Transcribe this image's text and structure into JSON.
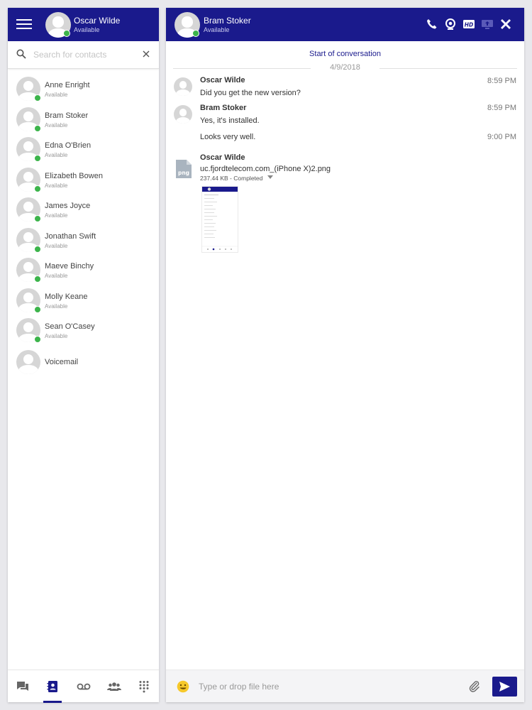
{
  "colors": {
    "brand": "#1a1a8c",
    "available": "#3cb44b"
  },
  "me": {
    "name": "Oscar Wilde",
    "status": "Available"
  },
  "search": {
    "placeholder": "Search for contacts",
    "value": ""
  },
  "contacts": [
    {
      "name": "Anne Enright",
      "status": "Available"
    },
    {
      "name": "Bram Stoker",
      "status": "Available"
    },
    {
      "name": "Edna O'Brien",
      "status": "Available"
    },
    {
      "name": "Elizabeth Bowen",
      "status": "Available"
    },
    {
      "name": "James Joyce",
      "status": "Available"
    },
    {
      "name": "Jonathan Swift",
      "status": "Available"
    },
    {
      "name": "Maeve Binchy",
      "status": "Available"
    },
    {
      "name": "Molly Keane",
      "status": "Available"
    },
    {
      "name": "Sean O'Casey",
      "status": "Available"
    },
    {
      "name": "Voicemail",
      "status": ""
    }
  ],
  "bottom_nav": [
    {
      "icon": "chat-icon",
      "active": false
    },
    {
      "icon": "contacts-book-icon",
      "active": true
    },
    {
      "icon": "voicemail-icon",
      "active": false
    },
    {
      "icon": "group-icon",
      "active": false
    },
    {
      "icon": "dialpad-icon",
      "active": false
    }
  ],
  "chat": {
    "contact": {
      "name": "Bram Stoker",
      "status": "Available"
    },
    "header_icons": [
      "phone-icon",
      "webcam-icon",
      "hd-icon",
      "screen-share-icon",
      "close-icon"
    ],
    "start_label": "Start of conversation",
    "date": "4/9/2018",
    "messages": [
      {
        "sender": "Oscar Wilde",
        "text": "Did you get the new version?",
        "time": "8:59 PM"
      },
      {
        "sender": "Bram Stoker",
        "text": "Yes, it's installed.",
        "time": "8:59 PM"
      },
      {
        "sender": "",
        "text": "Looks very well.",
        "time": "9:00 PM"
      }
    ],
    "file": {
      "sender": "Oscar Wilde",
      "icon_label": "png",
      "name": "uc.fjordtelecom.com_(iPhone X)2.png",
      "meta": "237.44 KB - Completed"
    },
    "composer_placeholder": "Type or drop file here"
  }
}
